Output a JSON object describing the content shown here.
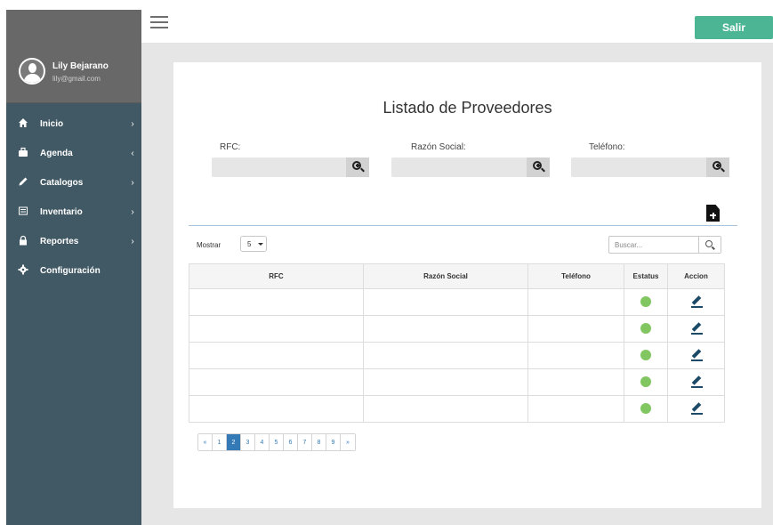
{
  "topbar": {
    "logout_label": "Salir"
  },
  "sidebar": {
    "user": {
      "name": "Lily Bejarano",
      "email": "lily@gmail.com"
    },
    "items": [
      {
        "label": "Inicio",
        "icon": "home-icon",
        "chevron": "›"
      },
      {
        "label": "Agenda",
        "icon": "briefcase-icon",
        "chevron": "‹"
      },
      {
        "label": "Catalogos",
        "icon": "pencil-icon",
        "chevron": "›"
      },
      {
        "label": "Inventario",
        "icon": "inventory-icon",
        "chevron": "›"
      },
      {
        "label": "Reportes",
        "icon": "lock-icon",
        "chevron": "›"
      },
      {
        "label": "Configuración",
        "icon": "gear-icon",
        "chevron": ""
      }
    ]
  },
  "main": {
    "title": "Listado de Proveedores",
    "filters": [
      {
        "label": "RFC:"
      },
      {
        "label": "Razón Social:"
      },
      {
        "label": "Teléfono:"
      }
    ],
    "show_label": "Mostrar",
    "page_size": "5",
    "search_placeholder": "Buscar...",
    "table": {
      "headers": [
        "RFC",
        "Razón Social",
        "Teléfono",
        "Estatus",
        "Accion"
      ],
      "rows": [
        {
          "rfc": "",
          "razon_social": "",
          "telefono": "",
          "estatus": "active"
        },
        {
          "rfc": "",
          "razon_social": "",
          "telefono": "",
          "estatus": "active"
        },
        {
          "rfc": "",
          "razon_social": "",
          "telefono": "",
          "estatus": "active"
        },
        {
          "rfc": "",
          "razon_social": "",
          "telefono": "",
          "estatus": "active"
        },
        {
          "rfc": "",
          "razon_social": "",
          "telefono": "",
          "estatus": "active"
        }
      ]
    },
    "pagination": {
      "prev": "«",
      "pages": [
        "1",
        "2",
        "3",
        "4",
        "5",
        "6",
        "7",
        "8",
        "9"
      ],
      "current": "2",
      "next": "»"
    }
  },
  "colors": {
    "sidebar": "#415965",
    "profile": "#686868",
    "accent": "#4cb593",
    "status_active": "#82c662",
    "edit_icon": "#1b4a68",
    "pager_active": "#337ab7"
  }
}
